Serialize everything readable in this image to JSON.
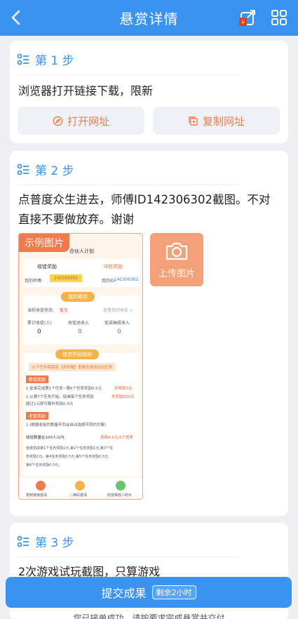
{
  "header": {
    "title": "悬赏详情"
  },
  "steps": [
    {
      "label": "第 1 步",
      "desc": "浏览器打开链接下载，限新",
      "btn_open": "打开网址",
      "btn_copy": "复制网址"
    },
    {
      "label": "第 2 步",
      "desc": "点普度众生进去，师傅ID142306302截图。不对直接不要做放弃。谢谢",
      "sample_tag": "示例图片",
      "upload_label": "上传图片"
    },
    {
      "label": "第 3 步",
      "desc": "2次游戏试玩截图，只算游戏"
    }
  ],
  "sample": {
    "plan": "合伙人计划",
    "tab_income": "收徒奖励",
    "tab_rank": "冲榜奖励",
    "my_master": "我的师傅:",
    "master_id": "142506302",
    "my_id_label": "我的ID:",
    "my_id": "142306302",
    "invite_title": "我的邀请",
    "current_status": "当前收徒状态:",
    "status_value": "暂无",
    "rules_link": "查看我的收徒 >",
    "col1": "累计收徒(人)",
    "col2": "收徒总收入",
    "col3": "徒弟抽成收入",
    "v1": "0",
    "v2": "0",
    "v3": "0",
    "rule_title": "徒弟奖励规则",
    "rule_banner": "以下任务需使用【游戏喵】里面的游戏试玩任务",
    "new_tag": "新徒奖励",
    "rule1": "1.徒弟完成第1个任务~第6个任务奖励0.5元",
    "rule1_amt": "共奖励3元",
    "rule2": "2.从第7个任务开始，徒弟每个任务奖励",
    "rule2b": "超过1元即可额外奖励0.4元",
    "rule2_amt": "共奖励500元",
    "old_tag": "老徒奖励",
    "rule3": "1.(根据收徒的数量不同会自动选择不同的方案)",
    "count_label": "收徒数量在100人以内:",
    "count_amt": "连续4.5元,6个任务",
    "detail1": "徒弟完成第1个任务奖励1元,第2个任务奖励1元,第3个任",
    "detail2": "务奖励1元，第4任务奖励0.5元,第5个任务奖励0.5元,",
    "detail3": "第6个任务奖励0.5元。",
    "bottom1": "复制链接邀请",
    "bottom2": "二维码邀请",
    "bottom3": "收徒审核小助手"
  },
  "submit": {
    "label": "提交成果",
    "remain": "剩余2小时"
  },
  "footer_tip": "您已接单成功，请按要求完成悬赏并交付"
}
